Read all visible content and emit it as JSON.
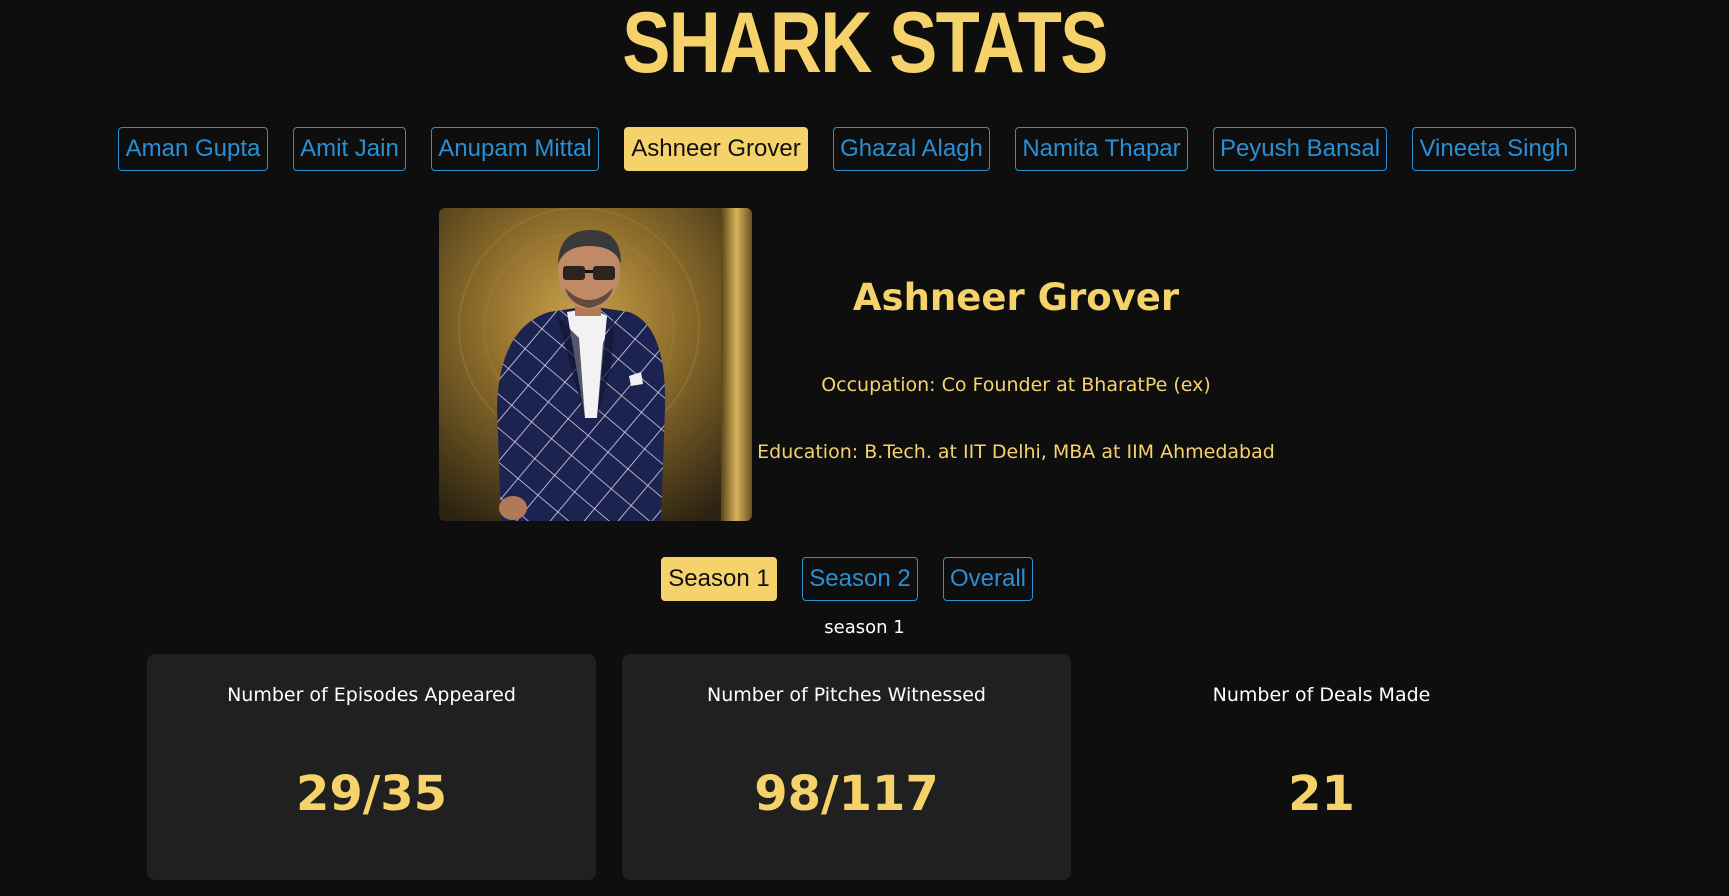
{
  "app": {
    "title": "SHARK STATS"
  },
  "sharks": [
    {
      "label": "Aman Gupta",
      "active": false
    },
    {
      "label": "Amit Jain",
      "active": false
    },
    {
      "label": "Anupam Mittal",
      "active": false
    },
    {
      "label": "Ashneer Grover",
      "active": true
    },
    {
      "label": "Ghazal Alagh",
      "active": false
    },
    {
      "label": "Namita Thapar",
      "active": false
    },
    {
      "label": "Peyush Bansal",
      "active": false
    },
    {
      "label": "Vineeta Singh",
      "active": false
    }
  ],
  "profile": {
    "name": "Ashneer Grover",
    "occupation": "Occupation: Co Founder at BharatPe (ex)",
    "education": "Education: B.Tech. at IIT Delhi, MBA at IIM Ahmedabad"
  },
  "seasons": {
    "tabs": [
      {
        "label": "Season 1",
        "active": true
      },
      {
        "label": "Season 2",
        "active": false
      },
      {
        "label": "Overall",
        "active": false
      }
    ],
    "current_label": "season 1"
  },
  "stats": [
    {
      "label": "Number of Episodes Appeared",
      "value": "29/35"
    },
    {
      "label": "Number of Pitches Witnessed",
      "value": "98/117"
    },
    {
      "label": "Number of Deals Made",
      "value": "21"
    }
  ],
  "colors": {
    "background": "#0e0e0e",
    "accent": "#f6d26a",
    "link": "#2a8fd3",
    "card": "#202020"
  }
}
